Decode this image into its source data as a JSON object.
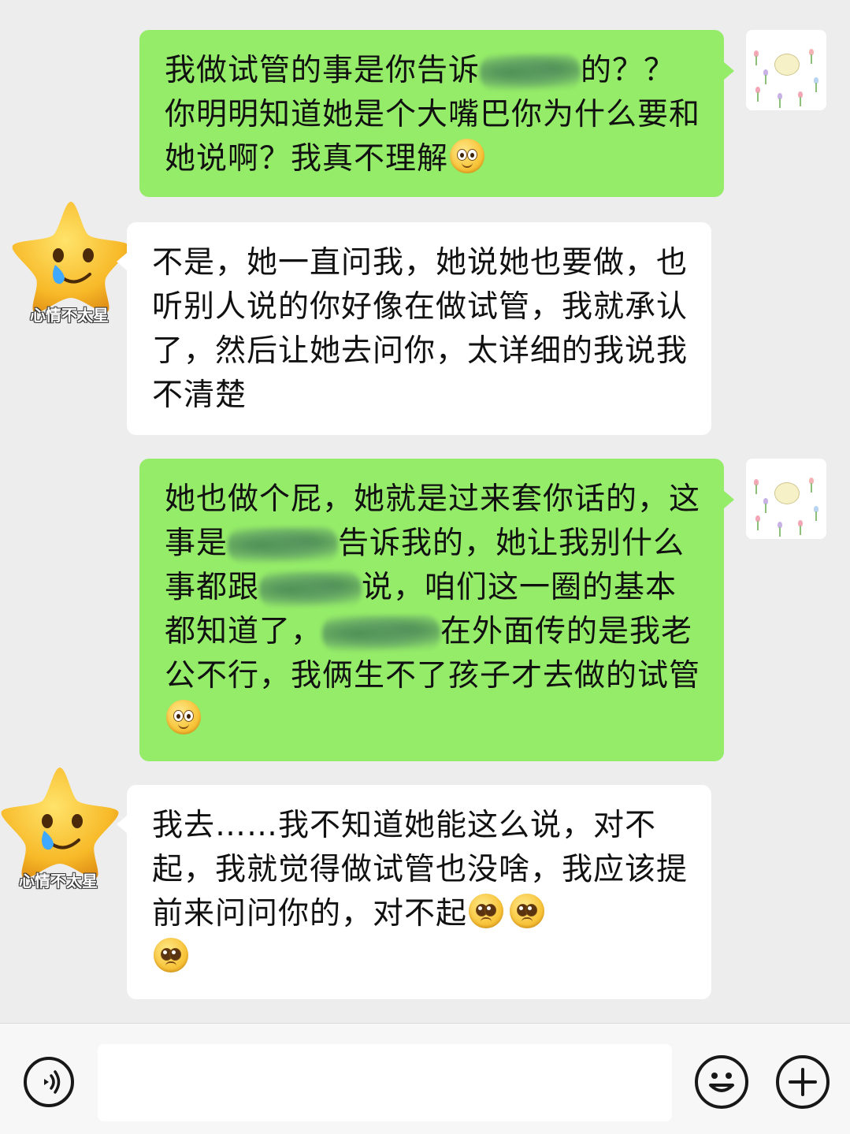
{
  "contact": {
    "name_label": "心情不太星"
  },
  "messages": [
    {
      "from": "me",
      "segments": [
        "我做试管的事是你告诉",
        "的？？你明明知道她是个大嘴巴你为什么要和她说啊？我真不理解"
      ],
      "trailing_emoji": "smile"
    },
    {
      "from": "them",
      "text": "不是，她一直问我，她说她也要做，也听别人说的你好像在做试管，我就承认了，然后让她去问你，太详细的我说我不清楚"
    },
    {
      "from": "me",
      "segments": [
        "她也做个屁，她就是过来套你话的，这事是",
        "告诉我的，她让我别什么事都跟",
        "说，咱们这一圈的基本都知道了，",
        "在外面传的是我老公不行，我俩生不了孩子才去做的试管"
      ],
      "trailing_emoji": "smile"
    },
    {
      "from": "them",
      "text": "我去……我不知道她能这么说，对不起，我就觉得做试管也没啥，我应该提前来问问你的，对不起",
      "trailing_emojis": [
        "pleading",
        "pleading",
        "pleading"
      ]
    }
  ],
  "bottombar": {
    "icons": [
      "voice-icon",
      "emoji-icon",
      "plus-icon"
    ],
    "input_value": ""
  },
  "colors": {
    "background": "#ededed",
    "my_bubble": "#95ec69",
    "their_bubble": "#ffffff"
  }
}
